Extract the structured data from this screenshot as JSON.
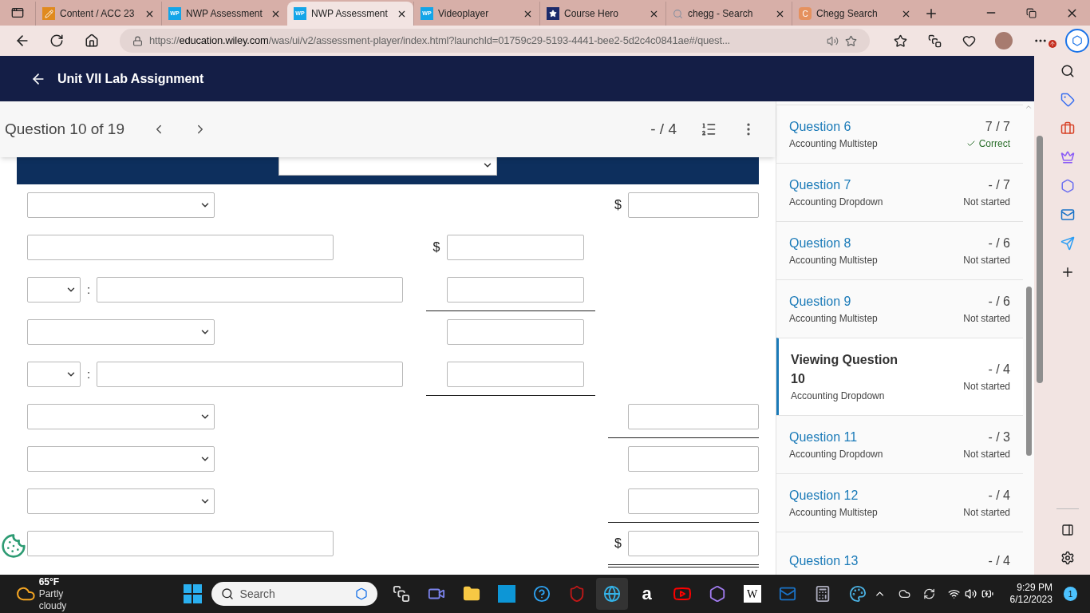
{
  "browser": {
    "tabs": [
      {
        "title": "Content / ACC 23",
        "kind": "pencil",
        "selected": false
      },
      {
        "title": "NWP Assessment",
        "kind": "wp",
        "badge": "WP",
        "selected": false
      },
      {
        "title": "NWP Assessment",
        "kind": "wp",
        "badge": "WP",
        "selected": true
      },
      {
        "title": "Videoplayer",
        "kind": "wp",
        "badge": "WP",
        "selected": false
      },
      {
        "title": "Course Hero",
        "kind": "star",
        "selected": false
      },
      {
        "title": "chegg - Search",
        "kind": "search",
        "selected": false
      },
      {
        "title": "Chegg Search",
        "kind": "letter",
        "badge": "C",
        "selected": false
      }
    ],
    "url_scheme": "https://",
    "url_host": "education.wiley.com",
    "url_path": "/was/ui/v2/assessment-player/index.html?launchId=01759c29-5193-4441-bee2-5d2c4c0841ae#/quest..."
  },
  "header": {
    "title": "Unit VII Lab Assignment"
  },
  "toolbar": {
    "question": "Question 10 of 19",
    "score": "- / 4"
  },
  "form": {
    "rows": [
      {
        "kind": "select",
        "amount": {
          "kind": "right",
          "currency": "$",
          "underline": false
        }
      },
      {
        "kind": "text",
        "amount": {
          "kind": "middle",
          "currency": "$",
          "underline": false
        }
      },
      {
        "kind": "ratio",
        "sep": ":",
        "amount": {
          "kind": "middle",
          "underline": true,
          "double": false
        }
      },
      {
        "kind": "select",
        "amount": {
          "kind": "middle",
          "underline": false
        }
      },
      {
        "kind": "ratio",
        "sep": ":",
        "amount": {
          "kind": "middle",
          "underline": true,
          "double": false
        }
      },
      {
        "kind": "select",
        "amount": {
          "kind": "right",
          "underline": true,
          "double": false
        }
      },
      {
        "kind": "select",
        "amount": {
          "kind": "right",
          "underline": false
        }
      },
      {
        "kind": "select",
        "amount": {
          "kind": "right",
          "underline": true,
          "double": false
        }
      },
      {
        "kind": "text",
        "amount": {
          "kind": "right",
          "currency": "$",
          "underline": true,
          "double": true
        }
      }
    ]
  },
  "questions": [
    {
      "title": "Question 6",
      "type": "Accounting Multistep",
      "score": "7 / 7",
      "status": "Correct",
      "correct": true,
      "selected": false
    },
    {
      "title": "Question 7",
      "type": "Accounting Dropdown",
      "score": "- / 7",
      "status": "Not started",
      "correct": false,
      "selected": false
    },
    {
      "title": "Question 8",
      "type": "Accounting Multistep",
      "score": "- / 6",
      "status": "Not started",
      "correct": false,
      "selected": false
    },
    {
      "title": "Question 9",
      "type": "Accounting Multistep",
      "score": "- / 6",
      "status": "Not started",
      "correct": false,
      "selected": false
    },
    {
      "title": "Viewing Question 10",
      "type": "Accounting Dropdown",
      "score": "- / 4",
      "status": "Not started",
      "correct": false,
      "selected": true
    },
    {
      "title": "Question 11",
      "type": "Accounting Dropdown",
      "score": "- / 3",
      "status": "Not started",
      "correct": false,
      "selected": false
    },
    {
      "title": "Question 12",
      "type": "Accounting Multistep",
      "score": "- / 4",
      "status": "Not started",
      "correct": false,
      "selected": false
    },
    {
      "title": "Question 13",
      "score": "- / 4",
      "selected": false
    }
  ],
  "taskbar": {
    "temperature": "65°F",
    "weather": "Partly cloudy",
    "search_placeholder": "Search",
    "apps": [
      {
        "kind": "taskview",
        "selected": false
      },
      {
        "kind": "meet",
        "selected": false
      },
      {
        "kind": "folder",
        "selected": false
      },
      {
        "kind": "hp",
        "selected": false
      },
      {
        "kind": "help",
        "selected": false
      },
      {
        "kind": "shield",
        "selected": false
      },
      {
        "kind": "edge",
        "selected": true
      },
      {
        "kind": "amazon",
        "glyph": "a",
        "selected": false
      },
      {
        "kind": "youtube",
        "selected": false
      },
      {
        "kind": "copilot",
        "selected": false
      },
      {
        "kind": "wiki",
        "glyph": "W",
        "selected": false
      },
      {
        "kind": "outlook",
        "selected": false
      },
      {
        "kind": "calculator",
        "selected": false
      },
      {
        "kind": "paint",
        "selected": false
      }
    ],
    "time": "9:29 PM",
    "date": "6/12/2023",
    "notifications": "1"
  }
}
